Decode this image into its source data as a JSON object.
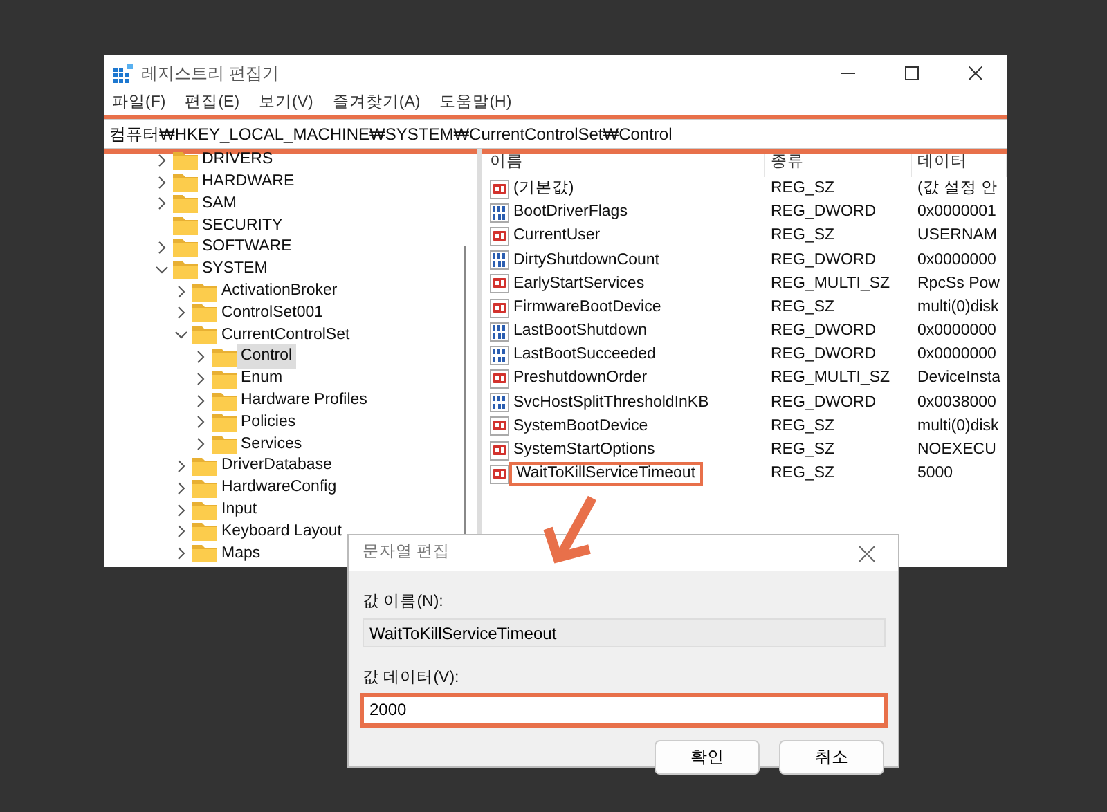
{
  "window": {
    "title": "레지스트리 편집기"
  },
  "menu": [
    "파일(F)",
    "편집(E)",
    "보기(V)",
    "즐겨찾기(A)",
    "도움말(H)"
  ],
  "address_bar": {
    "path": "컴퓨터₩HKEY_LOCAL_MACHINE₩SYSTEM₩CurrentControlSet₩Control",
    "highlighted": true
  },
  "tree": [
    {
      "label": "DRIVERS",
      "has_children": true,
      "expanded": false,
      "selected": false
    },
    {
      "label": "HARDWARE",
      "has_children": true,
      "expanded": false,
      "selected": false
    },
    {
      "label": "SAM",
      "has_children": true,
      "expanded": false,
      "selected": false
    },
    {
      "label": "SECURITY",
      "has_children": false,
      "selected": false
    },
    {
      "label": "SOFTWARE",
      "has_children": true,
      "expanded": false,
      "selected": false
    },
    {
      "label": "SYSTEM",
      "has_children": true,
      "expanded": true,
      "selected": false,
      "children": [
        {
          "label": "ActivationBroker",
          "has_children": true,
          "expanded": false,
          "selected": false
        },
        {
          "label": "ControlSet001",
          "has_children": true,
          "expanded": false,
          "selected": false
        },
        {
          "label": "CurrentControlSet",
          "has_children": true,
          "expanded": true,
          "selected": false,
          "children": [
            {
              "label": "Control",
              "has_children": true,
              "expanded": false,
              "selected": true
            },
            {
              "label": "Enum",
              "has_children": true,
              "expanded": false,
              "selected": false
            },
            {
              "label": "Hardware Profiles",
              "has_children": true,
              "expanded": false,
              "selected": false
            },
            {
              "label": "Policies",
              "has_children": true,
              "expanded": false,
              "selected": false
            },
            {
              "label": "Services",
              "has_children": true,
              "expanded": false,
              "selected": false
            }
          ]
        },
        {
          "label": "DriverDatabase",
          "has_children": true,
          "expanded": false,
          "selected": false
        },
        {
          "label": "HardwareConfig",
          "has_children": true,
          "expanded": false,
          "selected": false
        },
        {
          "label": "Input",
          "has_children": true,
          "expanded": false,
          "selected": false
        },
        {
          "label": "Keyboard Layout",
          "has_children": true,
          "expanded": false,
          "selected": false
        },
        {
          "label": "Maps",
          "has_children": true,
          "expanded": false,
          "selected": false
        }
      ]
    }
  ],
  "list": {
    "columns": [
      "이름",
      "종류",
      "데이터"
    ],
    "rows": [
      {
        "name": "(기본값)",
        "type": "REG_SZ",
        "data": "(값 설정 안",
        "kind": "string",
        "highlighted": false
      },
      {
        "name": "BootDriverFlags",
        "type": "REG_DWORD",
        "data": "0x0000001",
        "kind": "binary",
        "highlighted": false
      },
      {
        "name": "CurrentUser",
        "type": "REG_SZ",
        "data": "USERNAM",
        "kind": "string",
        "highlighted": false
      },
      {
        "name": "DirtyShutdownCount",
        "type": "REG_DWORD",
        "data": "0x0000000",
        "kind": "binary",
        "highlighted": false
      },
      {
        "name": "EarlyStartServices",
        "type": "REG_MULTI_SZ",
        "data": "RpcSs Pow",
        "kind": "string",
        "highlighted": false
      },
      {
        "name": "FirmwareBootDevice",
        "type": "REG_SZ",
        "data": "multi(0)disk",
        "kind": "string",
        "highlighted": false
      },
      {
        "name": "LastBootShutdown",
        "type": "REG_DWORD",
        "data": "0x0000000",
        "kind": "binary",
        "highlighted": false
      },
      {
        "name": "LastBootSucceeded",
        "type": "REG_DWORD",
        "data": "0x0000000",
        "kind": "binary",
        "highlighted": false
      },
      {
        "name": "PreshutdownOrder",
        "type": "REG_MULTI_SZ",
        "data": "DeviceInsta",
        "kind": "string",
        "highlighted": false
      },
      {
        "name": "SvcHostSplitThresholdInKB",
        "type": "REG_DWORD",
        "data": "0x0038000",
        "kind": "binary",
        "highlighted": false
      },
      {
        "name": "SystemBootDevice",
        "type": "REG_SZ",
        "data": "multi(0)disk",
        "kind": "string",
        "highlighted": false
      },
      {
        "name": "SystemStartOptions",
        "type": "REG_SZ",
        "data": "NOEXECU",
        "kind": "string",
        "highlighted": false
      },
      {
        "name": "WaitToKillServiceTimeout",
        "type": "REG_SZ",
        "data": "5000",
        "kind": "string",
        "highlighted": true
      }
    ]
  },
  "dialog": {
    "title": "문자열 편집",
    "name_label": "값 이름(N):",
    "name_value": "WaitToKillServiceTimeout",
    "data_label": "값 데이터(V):",
    "data_value": "2000",
    "data_highlighted": true,
    "buttons": [
      "확인",
      "취소"
    ]
  }
}
